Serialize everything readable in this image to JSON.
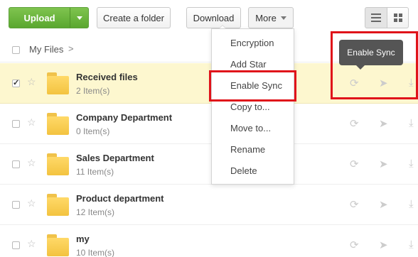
{
  "toolbar": {
    "upload_label": "Upload",
    "create_folder_label": "Create a folder",
    "download_label": "Download",
    "more_label": "More"
  },
  "breadcrumb": {
    "root": "My Files",
    "separator": ">"
  },
  "more_menu": {
    "items": [
      "Encryption",
      "Add Star",
      "Enable Sync",
      "Copy to...",
      "Move to...",
      "Rename",
      "Delete"
    ],
    "highlighted": "Enable Sync"
  },
  "tooltip": {
    "text": "Enable Sync"
  },
  "files": [
    {
      "name": "Received files",
      "count": "2 Item(s)",
      "selected": true
    },
    {
      "name": "Company Department",
      "count": "0 Item(s)",
      "selected": false
    },
    {
      "name": "Sales Department",
      "count": "11 Item(s)",
      "selected": false
    },
    {
      "name": "Product department",
      "count": "12 Item(s)",
      "selected": false
    },
    {
      "name": "my",
      "count": "10 Item(s)",
      "selected": false
    }
  ],
  "icons": {
    "upload_dropdown": "chevron-down-icon",
    "more_dropdown": "chevron-down-icon",
    "list_view": "list-view-icon",
    "grid_view": "grid-view-icon",
    "star": "star-icon",
    "folder": "folder-icon",
    "sync": "sync-icon",
    "share": "send-icon",
    "download": "download-icon"
  },
  "colors": {
    "upload_green": "#6bb63f",
    "selected_row": "#fdf7cf",
    "highlight_red": "#e0131a",
    "tooltip_bg": "#555555",
    "folder_yellow": "#f6c944"
  }
}
